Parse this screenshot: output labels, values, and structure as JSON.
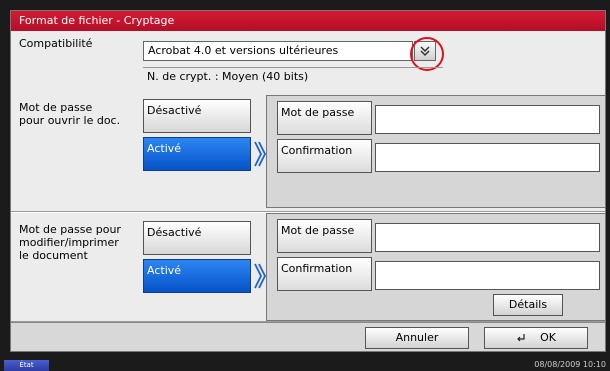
{
  "title": "Format de fichier - Cryptage",
  "compat": {
    "label": "Compatibilité",
    "value": "Acrobat 4.0 et versions ultérieures",
    "crypt_level": "N. de crypt. : Moyen (40 bits)"
  },
  "open_pw": {
    "label": "Mot de passe\npour ouvrir le doc.",
    "off_label": "Désactivé",
    "on_label": "Activé",
    "password_label": "Mot de passe",
    "confirm_label": "Confirmation"
  },
  "edit_pw": {
    "label": "Mot de passe pour\nmodifier/imprimer\nle document",
    "off_label": "Désactivé",
    "on_label": "Activé",
    "password_label": "Mot de passe",
    "confirm_label": "Confirmation",
    "details_label": "Détails"
  },
  "footer": {
    "cancel_label": "Annuler",
    "ok_label": "OK"
  },
  "status": {
    "tab_label": "État",
    "datetime": "08/08/2009   10:10"
  }
}
